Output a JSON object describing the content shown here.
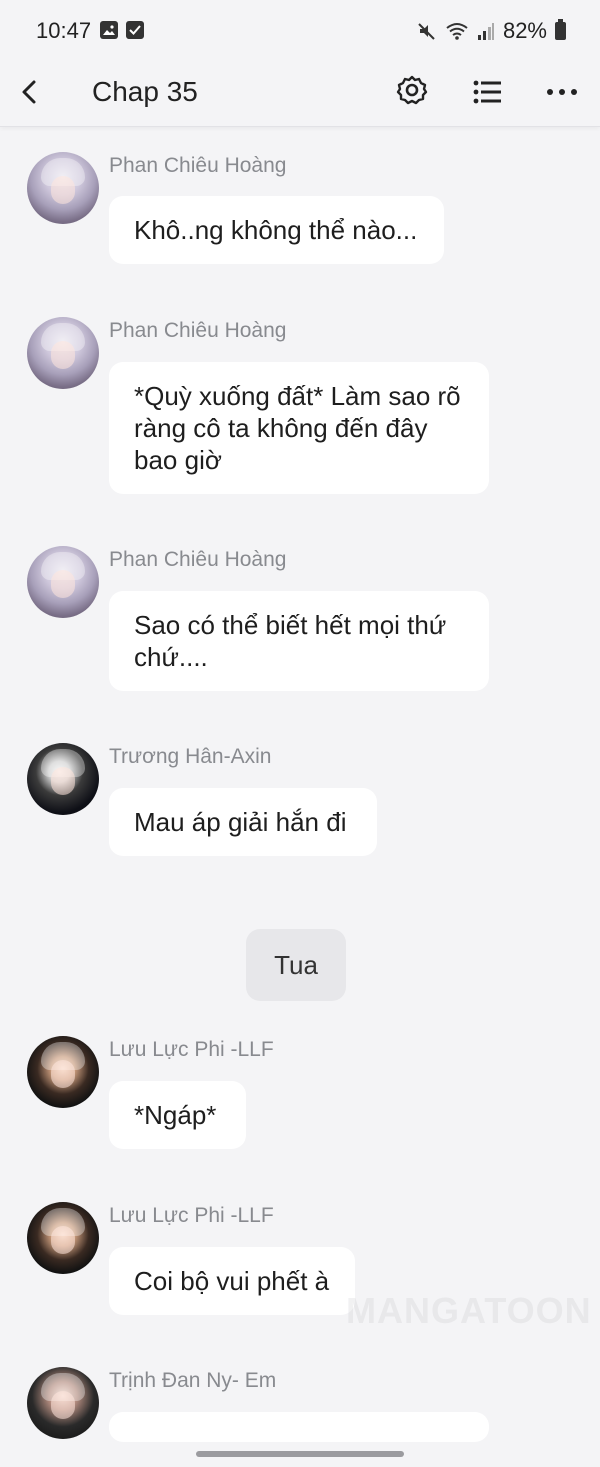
{
  "status": {
    "time": "10:47",
    "battery": "82%",
    "icons": [
      "gallery-icon",
      "checkbox-icon",
      "mute-icon",
      "wifi-icon",
      "signal-icon",
      "battery-icon"
    ]
  },
  "appbar": {
    "title": "Chap 35",
    "back_icon": "chevron-left-icon",
    "settings_icon": "gear-icon",
    "list_icon": "list-icon",
    "more_icon": "more-horizontal-icon"
  },
  "messages": [
    {
      "name": "Phan Chiêu Hoàng",
      "text": "Khô..ng không thể nào..."
    },
    {
      "name": "Phan Chiêu Hoàng",
      "text": "*Quỳ xuống đất* Làm sao rõ ràng cô ta không đến đây bao giờ"
    },
    {
      "name": "Phan Chiêu Hoàng",
      "text": "Sao có thể biết hết mọi thứ chứ...."
    },
    {
      "name": "Trương Hân-Axin",
      "text": "Mau áp giải hắn đi"
    },
    {
      "name": "Lưu Lực Phi -LLF",
      "text": "*Ngáp*"
    },
    {
      "name": "Lưu Lực Phi -LLF",
      "text": "Coi bộ vui phết à"
    },
    {
      "name": "Trịnh Đan Ny- Em",
      "text": ""
    }
  ],
  "narration": {
    "text": "Tua"
  },
  "watermark": "MANGATOON"
}
